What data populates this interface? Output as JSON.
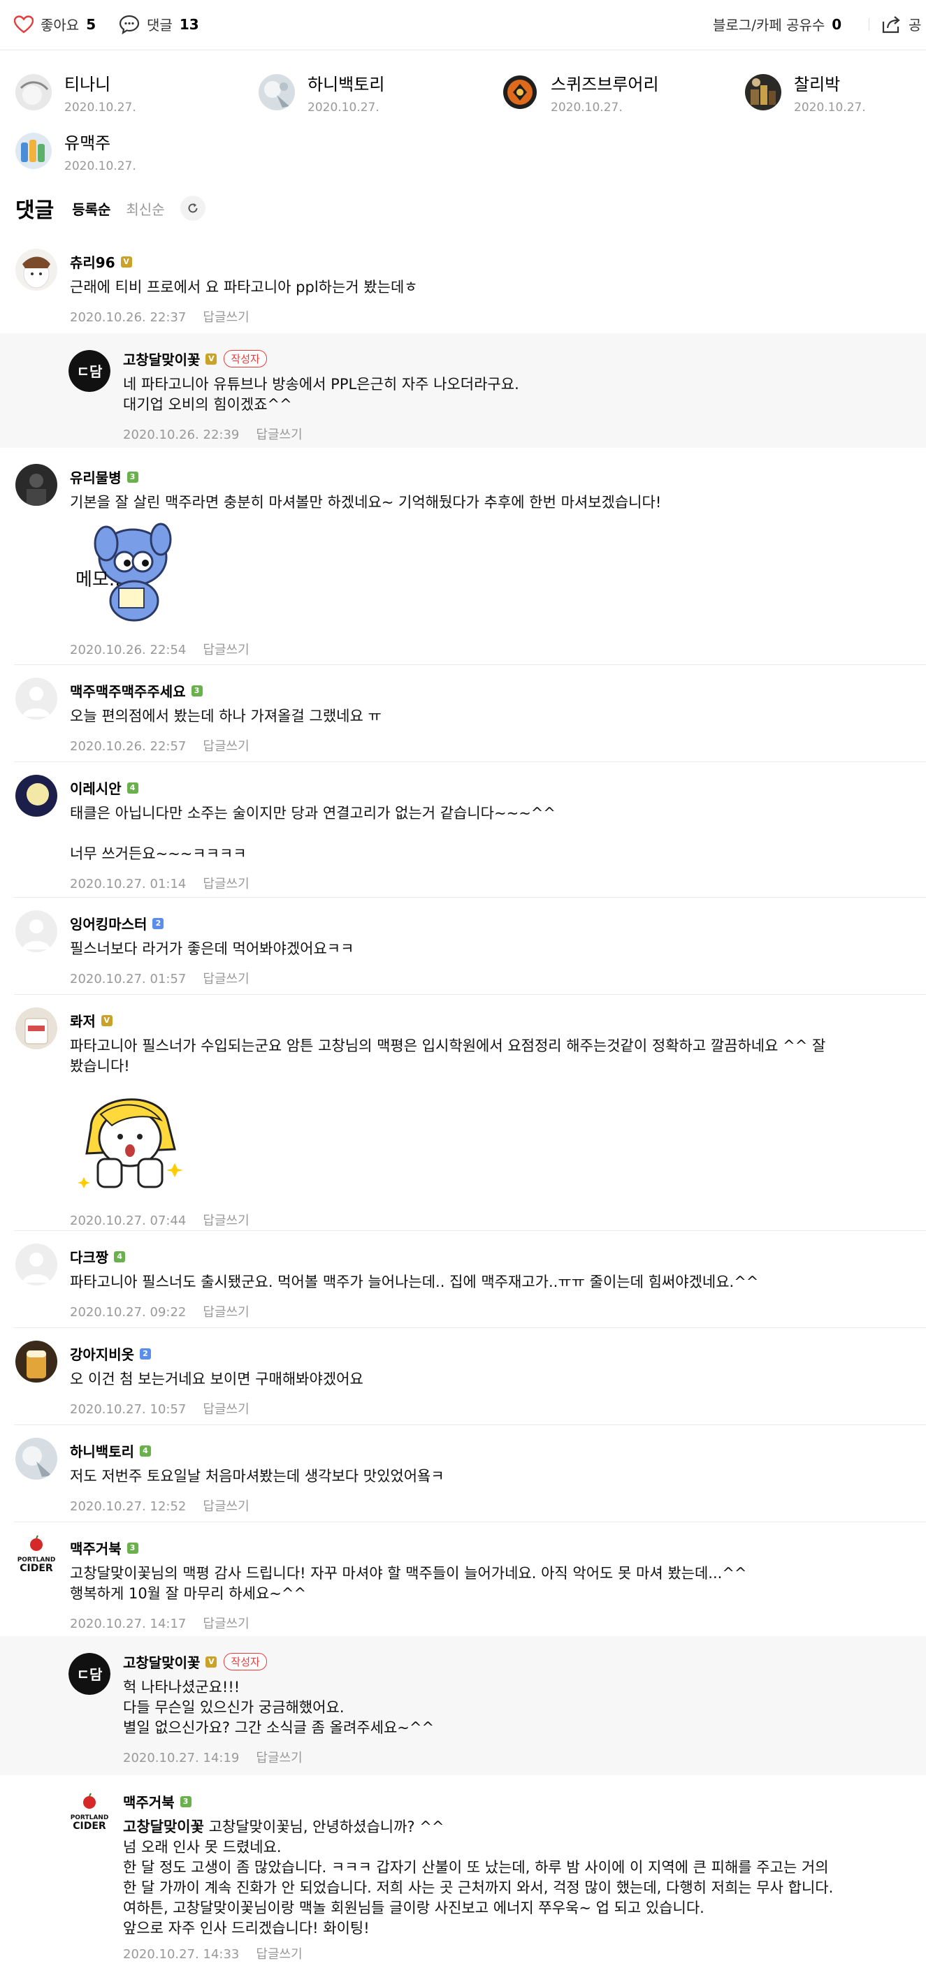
{
  "topbar": {
    "like_label": "좋아요",
    "like_count": "5",
    "comment_label": "댓글",
    "comment_count": "13",
    "share_label": "블로그/카페 공유수",
    "share_count": "0",
    "share_short": "공"
  },
  "likers": [
    {
      "name": "티나니",
      "date": "2020.10.27."
    },
    {
      "name": "하니백토리",
      "date": "2020.10.27."
    },
    {
      "name": "스퀴즈브루어리",
      "date": "2020.10.27."
    },
    {
      "name": "찰리박",
      "date": "2020.10.27."
    },
    {
      "name": "유맥주",
      "date": "2020.10.27."
    }
  ],
  "sort": {
    "title": "댓글",
    "option1": "등록순",
    "option2": "최신순"
  },
  "reply_label": "답글쓰기",
  "author_badge": "작성자",
  "sticker_memo_text": "메모..",
  "comments": [
    {
      "name": "츄리96",
      "level": "V",
      "text": "근래에 티비 프로에서 요 파타고니아 ppl하는거 봤는데ㅎ",
      "date": "2020.10.26. 22:37"
    },
    {
      "name": "고창달맞이꽃",
      "level": "V",
      "text": "네 파타고니아 유튜브나 방송에서 PPL은근히 자주 나오더라구요.\n대기업 오비의 힘이겠죠^^",
      "date": "2020.10.26. 22:39"
    },
    {
      "name": "유리물병",
      "level": "3",
      "text": "기본을 잘 살린 맥주라면 충분히 마셔볼만 하겠네요~ 기억해뒀다가 추후에 한번 마셔보겠습니다!",
      "date": "2020.10.26. 22:54"
    },
    {
      "name": "맥주맥주맥주주세요",
      "level": "3",
      "text": "오늘 편의점에서 봤는데 하나 가져올걸 그랬네요 ㅠ",
      "date": "2020.10.26. 22:57"
    },
    {
      "name": "이레시안",
      "level": "4",
      "text": "태클은 아닙니다만 소주는 술이지만 당과 연결고리가 없는거 같습니다~~~^^\n\n너무 쓰거든요~~~ㅋㅋㅋㅋ",
      "date": "2020.10.27. 01:14"
    },
    {
      "name": "잉어킹마스터",
      "level": "2",
      "text": "필스너보다 라거가 좋은데 먹어봐야겠어요ㅋㅋ",
      "date": "2020.10.27. 01:57"
    },
    {
      "name": "롸저",
      "level": "V",
      "text": "파타고니아 필스너가 수입되는군요 암튼 고창님의 맥평은 입시학원에서 요점정리 해주는것같이 정확하고 깔끔하네요 ^^ 잘\n봤습니다!",
      "date": "2020.10.27. 07:44"
    },
    {
      "name": "다크짱",
      "level": "4",
      "text": "파타고니아 필스너도 출시됐군요. 먹어볼 맥주가 늘어나는데.. 집에 맥주재고가..ㅠㅠ 줄이는데 힘써야겠네요.^^",
      "date": "2020.10.27. 09:22"
    },
    {
      "name": "강아지비옷",
      "level": "2",
      "text": "오 이건 첨 보는거네요 보이면 구매해봐야겠어요",
      "date": "2020.10.27. 10:57"
    },
    {
      "name": "하니백토리",
      "level": "4",
      "text": "저도 저번주 토요일날 처음마셔봤는데 생각보다 맛있었어욬ㅋ",
      "date": "2020.10.27. 12:52"
    },
    {
      "name": "맥주거북",
      "level": "3",
      "text": "고창달맞이꽃님의 맥평 감사 드립니다! 자꾸 마셔야 할 맥주들이 늘어가네요. 아직 악어도 못 마셔 봤는데...^^\n행복하게 10월 잘 마무리 하세요~^^",
      "date": "2020.10.27. 14:17"
    },
    {
      "name": "고창달맞이꽃",
      "level": "V",
      "text": "헉 나타나셨군요!!!\n다들 무슨일 있으신가 궁금해했어요.\n별일 없으신가요? 그간 소식글 좀 올려주세요~^^",
      "date": "2020.10.27. 14:19"
    },
    {
      "name": "맥주거북",
      "level": "3",
      "mention": "고창달맞이꽃",
      "text": " 고창달맞이꽃님, 안녕하셨습니까? ^^\n넘 오래 인사 못 드렸네요.\n한 달 정도 고생이 좀 많았습니다. ㅋㅋㅋ 갑자기 산불이 또 났는데, 하루 밤 사이에 이 지역에 큰 피해를 주고는 거의\n한 달 가까이 계속 진화가 안 되었습니다. 저희 사는 곳 근처까지 와서, 걱정 많이 했는데, 다행히 저희는 무사 합니다.\n여하튼, 고창달맞이꽃님이랑 맥놀 회원님들 글이랑 사진보고 에너지 쭈우욱~ 업 되고 있습니다.\n앞으로 자주 인사 드리겠습니다! 화이팅!",
      "date": "2020.10.27. 14:33"
    }
  ],
  "colors": {
    "accent_red": "#e63b3b",
    "gray_text": "#999999",
    "reply_bg": "#f7f7f7"
  }
}
